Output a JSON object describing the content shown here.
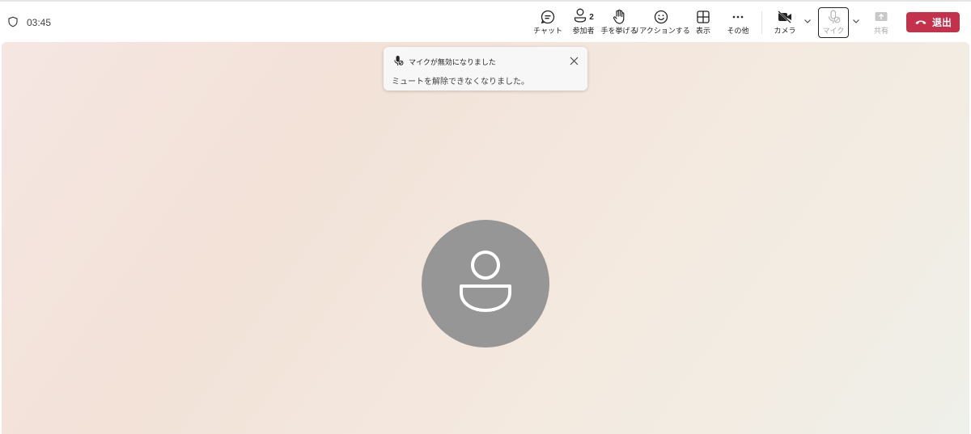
{
  "meeting": {
    "timer": "03:45"
  },
  "toolbar": {
    "chat_label": "チャット",
    "participants_label": "参加者",
    "participants_count": "2",
    "raise_hand_label": "手を挙げる",
    "react_label": "リアクションする",
    "view_label": "表示",
    "more_label": "その他",
    "camera_label": "カメラ",
    "mic_label": "マイク",
    "share_label": "共有",
    "leave_label": "退出"
  },
  "toast": {
    "title": "マイクが無効になりました",
    "body": "ミュートを解除できなくなりました。"
  },
  "colors": {
    "leave": "#c4314b",
    "avatar": "#969696"
  }
}
